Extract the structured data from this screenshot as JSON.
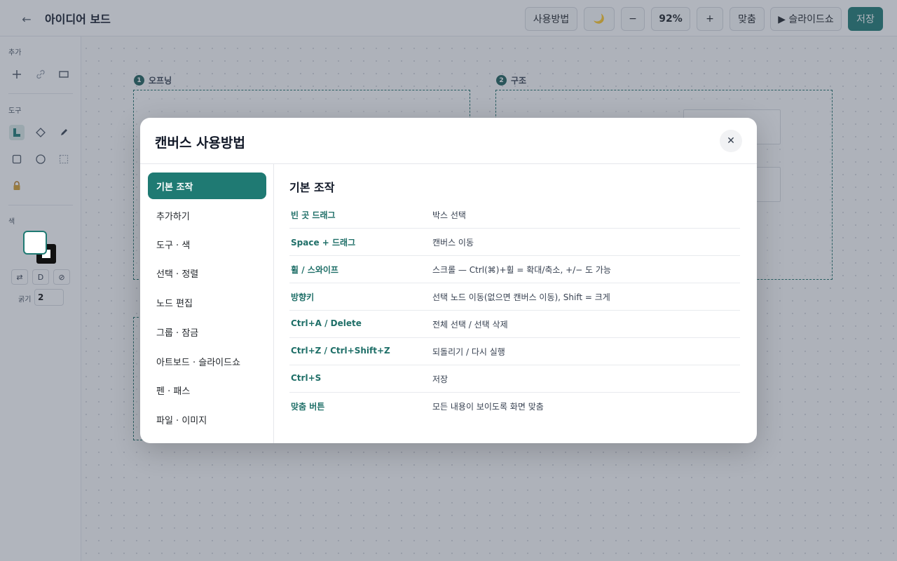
{
  "header": {
    "title": "아이디어 보드",
    "back_icon": "←",
    "buttons": {
      "help": "사용방법",
      "theme_icon": "🌙",
      "zoom_out": "−",
      "zoom_level": "92%",
      "zoom_in": "+",
      "fit": "맞춤",
      "slideshow": "▶ 슬라이드쇼",
      "save": "저장"
    }
  },
  "left_panel": {
    "sections": {
      "add": "추가",
      "tools": "도구",
      "color": "색"
    },
    "color_buttons": {
      "swap": "⇄",
      "default": "D",
      "none": "⊘"
    },
    "thickness_label": "굵기",
    "thickness_value": "2"
  },
  "canvas": {
    "artboards": [
      {
        "number": "1",
        "name": "오프닝"
      },
      {
        "number": "2",
        "name": "구조"
      }
    ]
  },
  "modal": {
    "title": "캔버스 사용방법",
    "close_icon": "✕",
    "nav": [
      {
        "label": "기본 조작",
        "active": true
      },
      {
        "label": "추가하기"
      },
      {
        "label": "도구 · 색"
      },
      {
        "label": "선택 · 정렬"
      },
      {
        "label": "노드 편집"
      },
      {
        "label": "그룹 · 잠금"
      },
      {
        "label": "아트보드 · 슬라이드쇼"
      },
      {
        "label": "펜 · 패스"
      },
      {
        "label": "파일 · 이미지"
      }
    ],
    "section_title": "기본 조작",
    "shortcuts": [
      {
        "key": "빈 곳 드래그",
        "desc": "박스 선택"
      },
      {
        "key": "Space + 드래그",
        "desc": "캔버스 이동"
      },
      {
        "key": "휠 / 스와이프",
        "desc": "스크롤 — Ctrl(⌘)+휠 = 확대/축소, +/− 도 가능"
      },
      {
        "key": "방향키",
        "desc": "선택 노드 이동(없으면 캔버스 이동), Shift = 크게"
      },
      {
        "key": "Ctrl+A / Delete",
        "desc": "전체 선택 / 선택 삭제"
      },
      {
        "key": "Ctrl+Z / Ctrl+Shift+Z",
        "desc": "되돌리기 / 다시 실행"
      },
      {
        "key": "Ctrl+S",
        "desc": "저장"
      },
      {
        "key": "맞춤 버튼",
        "desc": "모든 내용이 보이도록 화면 맞춤"
      }
    ]
  },
  "colors": {
    "accent": "#1f7a73",
    "accent_text": "#1f6f68"
  }
}
